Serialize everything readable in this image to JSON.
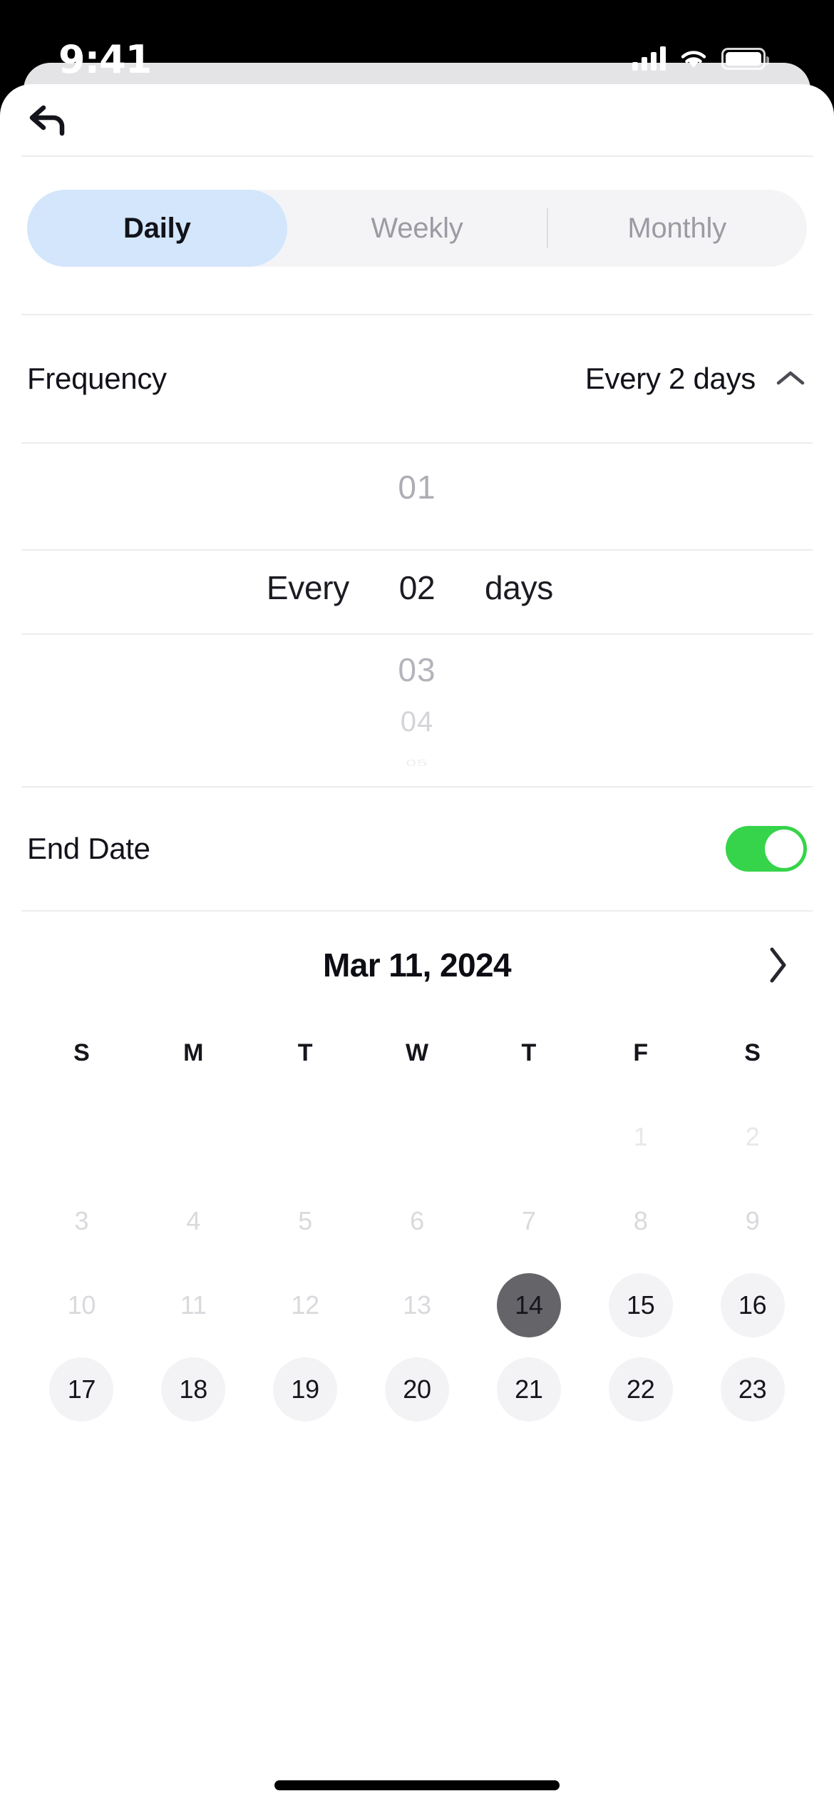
{
  "status_bar": {
    "time": "9:41",
    "signal_icon": "cellular-signal-icon",
    "wifi_icon": "wifi-icon",
    "battery_icon": "battery-icon"
  },
  "nav": {
    "back_icon": "back-arrow-icon"
  },
  "segmented_control": {
    "selected": "Daily",
    "options": [
      {
        "label": "Daily",
        "active": true
      },
      {
        "label": "Weekly",
        "active": false
      },
      {
        "label": "Monthly",
        "active": false
      }
    ]
  },
  "frequency_row": {
    "label": "Frequency",
    "value": "Every 2  days",
    "chevron_icon": "chevron-up-icon"
  },
  "picker": {
    "above_2": "",
    "above_1": "01",
    "selected": {
      "prefix": "Every",
      "number": "02",
      "unit": "days"
    },
    "below_1": "03",
    "below_2": "04",
    "below_3": "05"
  },
  "end_date_row": {
    "label": "End Date",
    "toggle_on": true,
    "toggle_color": "#35d44a"
  },
  "calendar": {
    "title": "Mar 11, 2024",
    "next_icon": "chevron-right-icon",
    "weekdays": [
      "S",
      "M",
      "T",
      "W",
      "T",
      "F",
      "S"
    ],
    "weeks": [
      [
        {
          "label": "",
          "state": "empty"
        },
        {
          "label": "",
          "state": "empty"
        },
        {
          "label": "",
          "state": "empty"
        },
        {
          "label": "",
          "state": "empty"
        },
        {
          "label": "",
          "state": "empty"
        },
        {
          "label": "1",
          "state": "veryfaint"
        },
        {
          "label": "2",
          "state": "veryfaint"
        }
      ],
      [
        {
          "label": "3",
          "state": "muted"
        },
        {
          "label": "4",
          "state": "muted"
        },
        {
          "label": "5",
          "state": "muted"
        },
        {
          "label": "6",
          "state": "muted"
        },
        {
          "label": "7",
          "state": "muted"
        },
        {
          "label": "8",
          "state": "muted"
        },
        {
          "label": "9",
          "state": "muted"
        }
      ],
      [
        {
          "label": "10",
          "state": "muted"
        },
        {
          "label": "11",
          "state": "muted"
        },
        {
          "label": "12",
          "state": "muted"
        },
        {
          "label": "13",
          "state": "muted"
        },
        {
          "label": "14",
          "state": "today"
        },
        {
          "label": "15",
          "state": "enabled"
        },
        {
          "label": "16",
          "state": "enabled"
        }
      ],
      [
        {
          "label": "17",
          "state": "enabled"
        },
        {
          "label": "18",
          "state": "enabled"
        },
        {
          "label": "19",
          "state": "enabled"
        },
        {
          "label": "20",
          "state": "enabled"
        },
        {
          "label": "21",
          "state": "enabled"
        },
        {
          "label": "22",
          "state": "enabled"
        },
        {
          "label": "23",
          "state": "enabled"
        }
      ]
    ]
  },
  "colors": {
    "accent_blue": "#d3e6fb",
    "toggle_green": "#35d44a",
    "today_gray": "#656569",
    "day_chip": "#f3f3f6",
    "divider": "#ececef"
  }
}
